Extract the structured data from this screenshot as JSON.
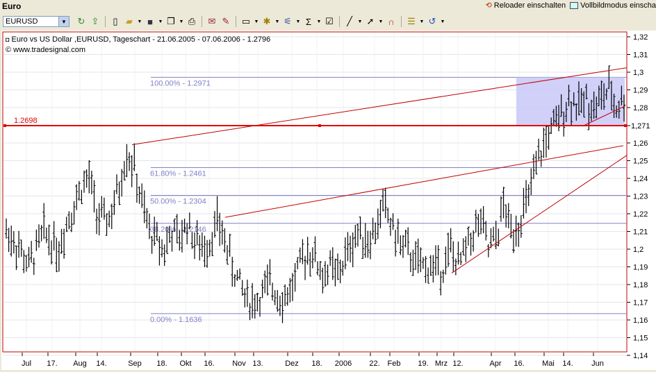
{
  "window": {
    "title": "Euro"
  },
  "top_buttons": [
    {
      "label": "Reloader einschalten",
      "icon": "reload-icon"
    },
    {
      "label": "Vollbildmodus einscha",
      "icon": "fullscreen-icon"
    }
  ],
  "toolbar": {
    "symbol_value": "EURUSD",
    "buttons": [
      "refresh-icon",
      "export-icon",
      "new-document-icon",
      "open-folder-icon",
      "save-icon",
      "copy-icon",
      "print-icon",
      "chart-mail-icon",
      "chart-edit-icon",
      "chart-layout-icon",
      "indicator-icon",
      "draw-tools-icon",
      "sum-icon",
      "properties-icon",
      "line-tool-icon",
      "pointer-icon",
      "magnet-icon",
      "notes-icon",
      "reload-circle-icon"
    ]
  },
  "chart": {
    "legend_line1": "Euro vs US Dollar ,EURUSD, Tageschart - 21.06.2005 - 07.06.2006 - 1.2796",
    "legend_line2": "© www.tradesignal.com",
    "price_line_label": "1.2698",
    "price_line_axis_label": "1,271",
    "fib_labels": [
      "100.00% - 1.2971",
      "61.80% - 1.2461",
      "50.00% - 1.2304",
      "38.20% - 1.2146",
      "0.00% - 1.1636"
    ],
    "y_ticks": [
      "1,32",
      "1,31",
      "1,3",
      "1,29",
      "1,28",
      "1,26",
      "1,25",
      "1,24",
      "1,23",
      "1,22",
      "1,21",
      "1,2",
      "1,19",
      "1,18",
      "1,17",
      "1,16",
      "1,15",
      "1,14"
    ],
    "x_ticks": [
      "Jul",
      "17.",
      "Aug",
      "14.",
      "Sep",
      "18.",
      "Okt",
      "16.",
      "Nov",
      "13.",
      "Dez",
      "18.",
      "2006",
      "22.",
      "Feb",
      "19.",
      "Mrz",
      "12.",
      "Apr",
      "16.",
      "Mai",
      "14.",
      "Jun"
    ],
    "colors": {
      "support_line": "#e00000",
      "trend_line": "#c00000",
      "fib_line": "#8080c8",
      "fib_text": "#8080c8",
      "bars": "#000000",
      "zone": "#c8c8f8"
    }
  },
  "chart_data": {
    "type": "bar",
    "title": "Euro vs US Dollar ,EURUSD, Tageschart - 21.06.2005 - 07.06.2006 - 1.2796",
    "ylim": [
      1.14,
      1.32
    ],
    "horizontal_line": 1.2698,
    "fibonacci": [
      {
        "label": "100.00%",
        "value": 1.2971
      },
      {
        "label": "61.80%",
        "value": 1.2461
      },
      {
        "label": "50.00%",
        "value": 1.2304
      },
      {
        "label": "38.20%",
        "value": 1.2146
      },
      {
        "label": "0.00%",
        "value": 1.1636
      }
    ],
    "anchors": [
      [
        0,
        1.21
      ],
      [
        3,
        1.205
      ],
      [
        6,
        1.198
      ],
      [
        9,
        1.19
      ],
      [
        12,
        1.2
      ],
      [
        15,
        1.21
      ],
      [
        18,
        1.205
      ],
      [
        21,
        1.2
      ],
      [
        24,
        1.215
      ],
      [
        27,
        1.225
      ],
      [
        30,
        1.235
      ],
      [
        33,
        1.24
      ],
      [
        36,
        1.22
      ],
      [
        39,
        1.215
      ],
      [
        42,
        1.22
      ],
      [
        45,
        1.235
      ],
      [
        48,
        1.255
      ],
      [
        51,
        1.245
      ],
      [
        54,
        1.225
      ],
      [
        57,
        1.21
      ],
      [
        60,
        1.205
      ],
      [
        63,
        1.2
      ],
      [
        66,
        1.21
      ],
      [
        69,
        1.205
      ],
      [
        72,
        1.215
      ],
      [
        75,
        1.205
      ],
      [
        78,
        1.2
      ],
      [
        81,
        1.205
      ],
      [
        84,
        1.215
      ],
      [
        87,
        1.205
      ],
      [
        90,
        1.19
      ],
      [
        93,
        1.18
      ],
      [
        96,
        1.172
      ],
      [
        99,
        1.17
      ],
      [
        102,
        1.175
      ],
      [
        105,
        1.18
      ],
      [
        108,
        1.175
      ],
      [
        111,
        1.172
      ],
      [
        114,
        1.18
      ],
      [
        117,
        1.19
      ],
      [
        120,
        1.2
      ],
      [
        123,
        1.195
      ],
      [
        126,
        1.185
      ],
      [
        129,
        1.19
      ],
      [
        132,
        1.185
      ],
      [
        135,
        1.195
      ],
      [
        138,
        1.205
      ],
      [
        141,
        1.21
      ],
      [
        144,
        1.205
      ],
      [
        147,
        1.21
      ],
      [
        150,
        1.225
      ],
      [
        153,
        1.215
      ],
      [
        156,
        1.205
      ],
      [
        159,
        1.2
      ],
      [
        162,
        1.195
      ],
      [
        165,
        1.19
      ],
      [
        168,
        1.19
      ],
      [
        171,
        1.19
      ],
      [
        174,
        1.19
      ],
      [
        177,
        1.2
      ],
      [
        180,
        1.19
      ],
      [
        183,
        1.2
      ],
      [
        186,
        1.21
      ],
      [
        189,
        1.215
      ],
      [
        192,
        1.2
      ],
      [
        195,
        1.205
      ],
      [
        198,
        1.225
      ],
      [
        201,
        1.21
      ],
      [
        204,
        1.215
      ],
      [
        207,
        1.225
      ],
      [
        210,
        1.24
      ],
      [
        213,
        1.255
      ],
      [
        216,
        1.265
      ],
      [
        219,
        1.27
      ],
      [
        222,
        1.28
      ],
      [
        225,
        1.285
      ],
      [
        228,
        1.28
      ],
      [
        231,
        1.285
      ],
      [
        234,
        1.28
      ],
      [
        237,
        1.285
      ],
      [
        240,
        1.29
      ],
      [
        243,
        1.28
      ],
      [
        246,
        1.285
      ]
    ],
    "x_count": 247
  }
}
